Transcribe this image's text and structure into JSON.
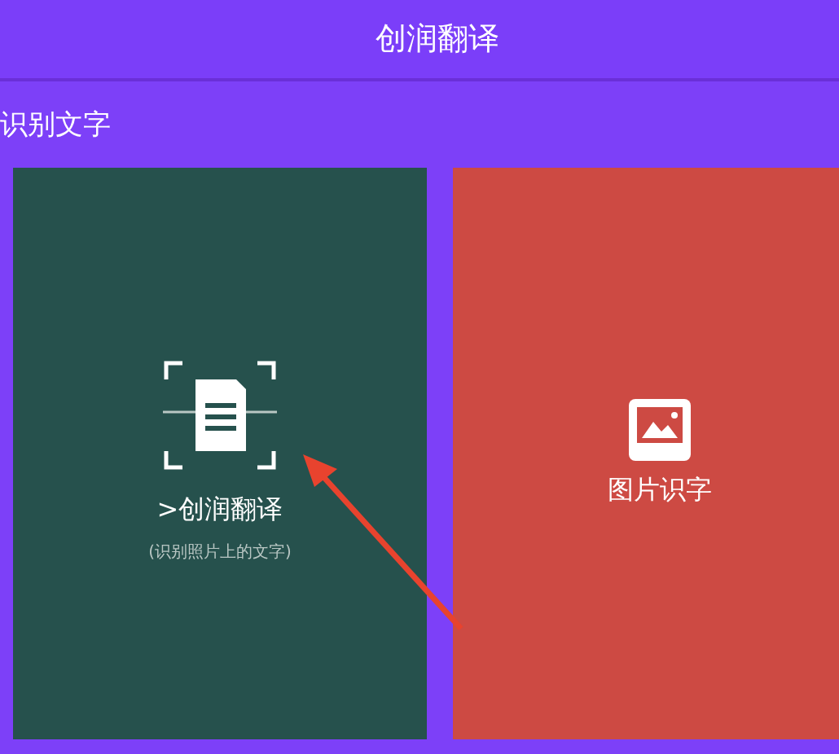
{
  "header": {
    "title": "创润翻译"
  },
  "section": {
    "title": "识别文字"
  },
  "cards": [
    {
      "kind": "scan",
      "color": "#26514d",
      "title": ">创润翻译",
      "subtitle": "(识别照片上的文字)"
    },
    {
      "kind": "image",
      "color": "#cd4a43",
      "title": "图片识字"
    }
  ]
}
